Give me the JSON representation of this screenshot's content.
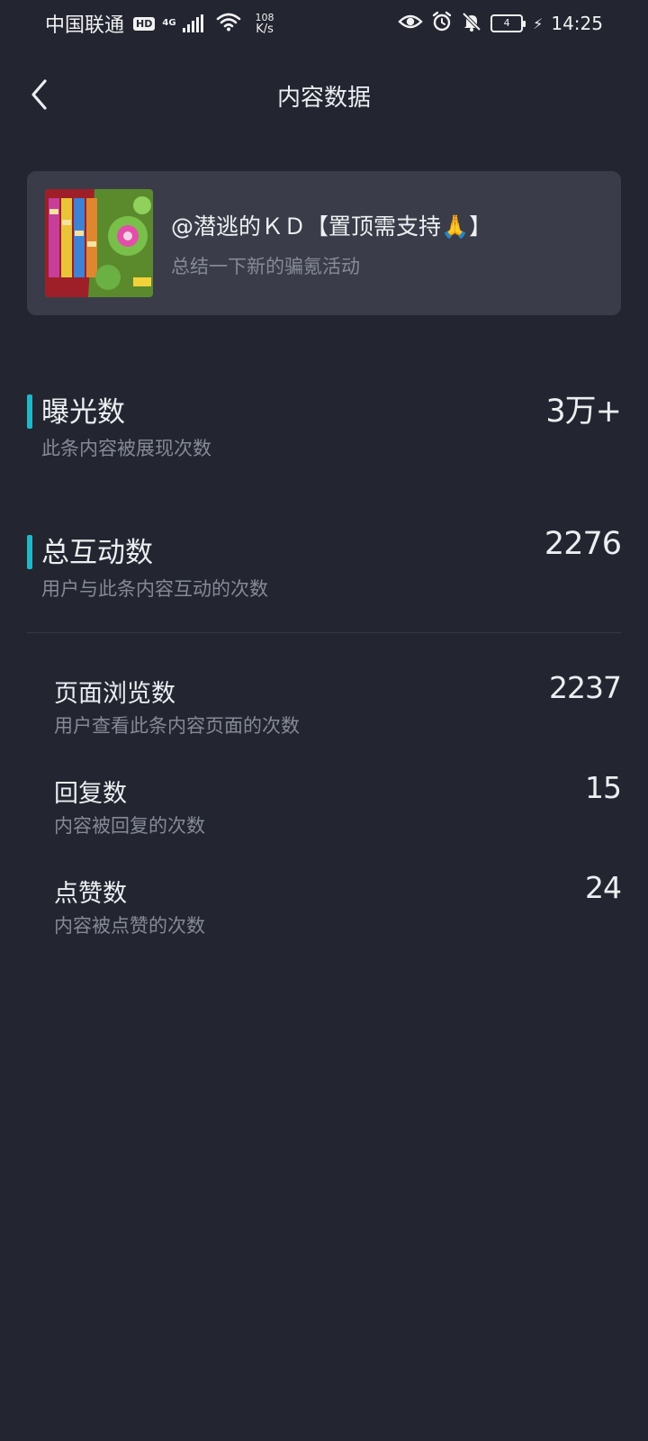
{
  "status_bar": {
    "carrier": "中国联通",
    "hd_label": "HD",
    "network_gen": "4G",
    "speed_value": "108",
    "speed_unit": "K/s",
    "battery_level": "4",
    "time": "14:25",
    "icons": [
      "signal-icon",
      "wifi-icon",
      "eye-icon",
      "alarm-icon",
      "notifications-off-icon",
      "battery-icon",
      "charging-icon"
    ]
  },
  "header": {
    "title": "内容数据",
    "back_icon": "chevron-left-icon"
  },
  "post": {
    "title": "@潜逃的ＫＤ【置顶需支持🙏】",
    "subtitle": "总结一下新的骗氪活动"
  },
  "metrics": [
    {
      "label": "曝光数",
      "value": "3万+",
      "description": "此条内容被展现次数"
    },
    {
      "label": "总互动数",
      "value": "2276",
      "description": "用户与此条内容互动的次数"
    }
  ],
  "sub_metrics": [
    {
      "label": "页面浏览数",
      "value": "2237",
      "description": "用户查看此条内容页面的次数"
    },
    {
      "label": "回复数",
      "value": "15",
      "description": "内容被回复的次数"
    },
    {
      "label": "点赞数",
      "value": "24",
      "description": "内容被点赞的次数"
    }
  ],
  "colors": {
    "background": "#232631",
    "card": "#3a3d49",
    "accent": "#21b7c6",
    "text_primary": "#eceef1",
    "text_secondary": "#868a96"
  }
}
